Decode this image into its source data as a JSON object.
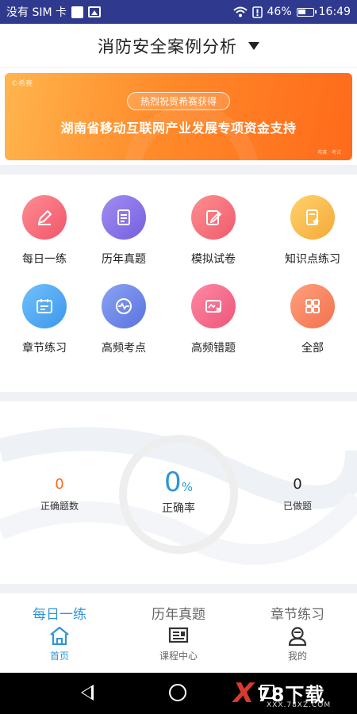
{
  "status_bar": {
    "carrier": "没有 SIM 卡",
    "battery": "46%",
    "time": "16:49",
    "icons": [
      "notification-square-icon",
      "gallery-icon",
      "wifi-icon",
      "alert-icon",
      "battery-icon"
    ]
  },
  "header": {
    "title": "消防安全案例分析",
    "dropdown_icon": "triangle-down-icon"
  },
  "banner": {
    "logo": "©希赛",
    "pill": "热烈祝贺希赛获得",
    "headline": "湖南省移动互联网产业发展专项资金支持",
    "footer": "希赛 · 考试"
  },
  "grid": {
    "items": [
      {
        "label": "每日一练",
        "icon": "pencil-icon",
        "color": "#f26d7d"
      },
      {
        "label": "历年真题",
        "icon": "document-list-icon",
        "color": "#8b73e8"
      },
      {
        "label": "模拟试卷",
        "icon": "edit-paper-icon",
        "color": "#f26d7d"
      },
      {
        "label": "知识点练习",
        "icon": "star-document-icon",
        "color": "#f7b84a"
      },
      {
        "label": "章节练习",
        "icon": "calendar-check-icon",
        "color": "#4aa8ef"
      },
      {
        "label": "高频考点",
        "icon": "pulse-check-icon",
        "color": "#6d86e8"
      },
      {
        "label": "高频错题",
        "icon": "error-card-icon",
        "color": "#f06a88"
      },
      {
        "label": "全部",
        "icon": "grid-icon",
        "color": "#f58a66"
      }
    ]
  },
  "stats": {
    "correct_count": "0",
    "correct_count_label": "正确题数",
    "accuracy": "0",
    "accuracy_unit": "%",
    "accuracy_label": "正确率",
    "done_count": "0",
    "done_count_label": "已做题"
  },
  "quick_tabs": [
    "每日一练",
    "历年真题",
    "章节练习"
  ],
  "bottom_nav": [
    {
      "label": "首页",
      "icon": "home-icon",
      "active": true
    },
    {
      "label": "课程中心",
      "icon": "course-icon",
      "active": false
    },
    {
      "label": "我的",
      "icon": "profile-icon",
      "active": false
    }
  ],
  "watermark": {
    "brand": "78下载",
    "prefix": "X",
    "sub": "XXX.78XZ.COM"
  },
  "colors": {
    "accent": "#2f95d8",
    "status_bar": "#2f3a8f",
    "banner_orange": "#ff8a2a",
    "count_orange": "#ff6a1a"
  }
}
